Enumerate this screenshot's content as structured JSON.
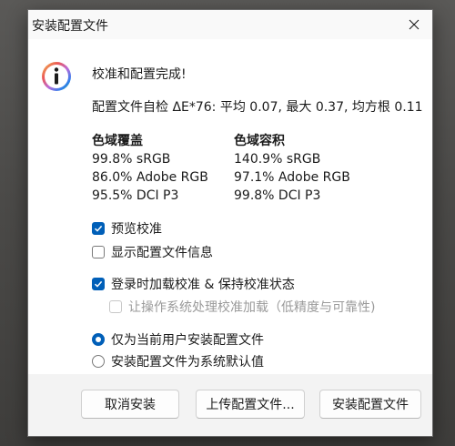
{
  "window": {
    "title": "安装配置文件",
    "close_icon": "close-icon"
  },
  "message": {
    "icon": "info-icon",
    "heading": "校准和配置完成!",
    "selfcheck": "配置文件自检 ΔE*76: 平均 0.07, 最大 0.37, 均方根 0.11"
  },
  "gamut_coverage": {
    "title": "色域覆盖",
    "lines": [
      "99.8% sRGB",
      "86.0% Adobe RGB",
      "95.5% DCI P3"
    ]
  },
  "gamut_volume": {
    "title": "色域容积",
    "lines": [
      "140.9% sRGB",
      "97.1% Adobe RGB",
      "99.8% DCI P3"
    ]
  },
  "options": {
    "preview_calibration": {
      "label": "预览校准",
      "checked": true
    },
    "show_profile_info": {
      "label": "显示配置文件信息",
      "checked": false
    },
    "load_on_login": {
      "label": "登录时加载校准 & 保持校准状态",
      "checked": true
    },
    "os_handles_loading": {
      "label": "让操作系统处理校准加载（低精度与可靠性)",
      "checked": false,
      "disabled": true
    }
  },
  "install_scope": {
    "current_user": {
      "label": "仅为当前用户安装配置文件",
      "selected": true
    },
    "system_default": {
      "label": "安装配置文件为系统默认值",
      "selected": false
    }
  },
  "buttons": {
    "cancel": "取消安装",
    "upload": "上传配置文件...",
    "install": "安装配置文件"
  },
  "colors": {
    "accent": "#005fb8",
    "dialog_bg": "#ffffff",
    "footer_bg": "#f3f3f3"
  }
}
